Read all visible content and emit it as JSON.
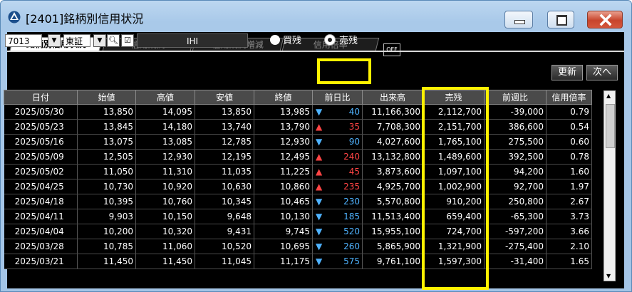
{
  "window": {
    "title": "[2401]銘柄別信用状況"
  },
  "tabs": [
    "銘柄別信用状況",
    "信用残高",
    "信用残高増減",
    "信用倍率"
  ],
  "off_label": "OFF",
  "toolbar": {
    "code": "7013",
    "market": "東証",
    "name": "IHI",
    "radio_buy": "買残",
    "radio_sell": "売残",
    "selected": "売残",
    "update": "更新",
    "next": "次へ"
  },
  "table": {
    "headers": [
      "日付",
      "始値",
      "高値",
      "安値",
      "終値",
      "前日比",
      "出来高",
      "売残",
      "前週比",
      "信用倍率"
    ],
    "rows": [
      [
        "2025/05/30",
        "13,850",
        "14,095",
        "13,850",
        "13,985",
        "down",
        "40",
        "11,166,300",
        "2,112,700",
        "-39,000",
        "0.79"
      ],
      [
        "2025/05/23",
        "13,845",
        "14,180",
        "13,740",
        "13,790",
        "up",
        "35",
        "7,708,300",
        "2,151,700",
        "386,600",
        "0.54"
      ],
      [
        "2025/05/16",
        "13,075",
        "13,085",
        "12,785",
        "12,930",
        "down",
        "90",
        "4,027,600",
        "1,765,100",
        "275,500",
        "0.60"
      ],
      [
        "2025/05/09",
        "12,505",
        "12,930",
        "12,195",
        "12,495",
        "up",
        "240",
        "13,132,800",
        "1,489,600",
        "392,500",
        "0.78"
      ],
      [
        "2025/05/02",
        "11,050",
        "11,310",
        "11,035",
        "11,225",
        "up",
        "45",
        "3,873,600",
        "1,097,100",
        "94,200",
        "1.60"
      ],
      [
        "2025/04/25",
        "10,730",
        "10,920",
        "10,630",
        "10,860",
        "up",
        "235",
        "4,925,700",
        "1,002,900",
        "92,700",
        "1.97"
      ],
      [
        "2025/04/18",
        "10,395",
        "10,760",
        "10,345",
        "10,465",
        "down",
        "230",
        "5,570,800",
        "910,200",
        "250,800",
        "2.67"
      ],
      [
        "2025/04/11",
        "9,903",
        "10,150",
        "9,648",
        "10,130",
        "down",
        "185",
        "11,513,400",
        "659,400",
        "-65,300",
        "3.73"
      ],
      [
        "2025/04/04",
        "10,200",
        "10,320",
        "9,431",
        "9,745",
        "down",
        "520",
        "15,955,100",
        "724,700",
        "-597,200",
        "3.66"
      ],
      [
        "2025/03/28",
        "10,785",
        "11,060",
        "10,520",
        "10,695",
        "down",
        "260",
        "5,865,900",
        "1,321,900",
        "-275,400",
        "2.10"
      ],
      [
        "2025/03/21",
        "11,450",
        "11,450",
        "11,045",
        "11,175",
        "down",
        "575",
        "9,761,100",
        "1,597,300",
        "-31,400",
        "1.65"
      ]
    ]
  },
  "colors": {
    "up": "#ff4444",
    "down": "#4fb3ff",
    "highlight": "#fff200"
  }
}
